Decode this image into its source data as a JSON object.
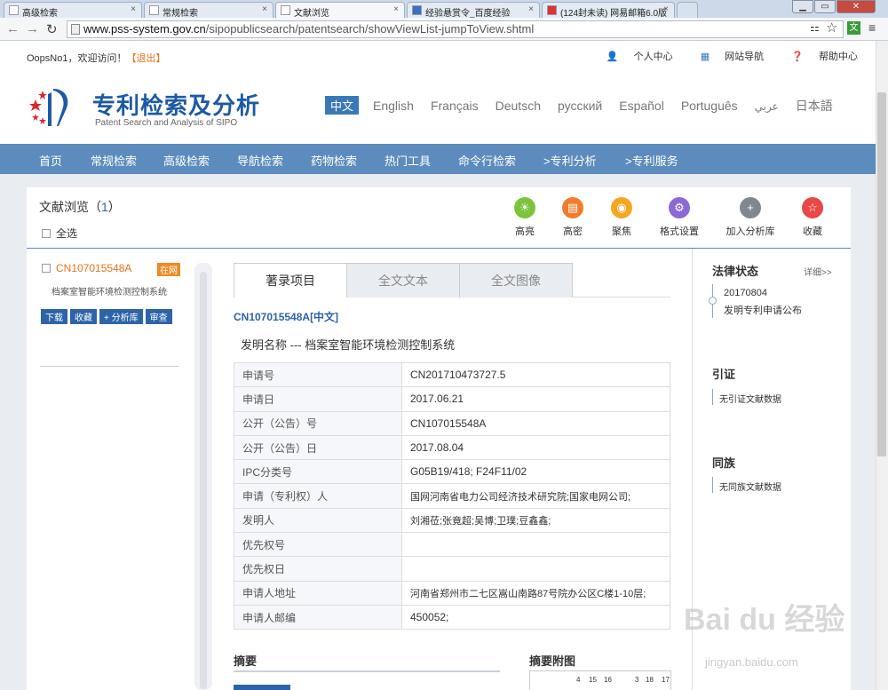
{
  "browser": {
    "tabs": [
      {
        "label": "高级检索"
      },
      {
        "label": "常规检索"
      },
      {
        "label": "文献浏览"
      },
      {
        "label": "经验悬赏令_百度经验"
      },
      {
        "label": "(124封未读) 网易邮箱6.0版"
      }
    ],
    "url_host": "www.pss-system.gov.cn",
    "url_path": "/sipopublicsearch/patentsearch/showViewList-jumpToView.shtml"
  },
  "topbar": {
    "welcome": "OopsNo1，欢迎访问！",
    "logout": "【退出】",
    "links": [
      "个人中心",
      "网站导航",
      "帮助中心"
    ]
  },
  "header": {
    "title": "专利检索及分析",
    "subtitle": "Patent Search and Analysis of SIPO",
    "current_lang": "中文",
    "languages": [
      "English",
      "Français",
      "Deutsch",
      "русский",
      "Español",
      "Português",
      "عربي",
      "日本語"
    ]
  },
  "nav": [
    "首页",
    "常规检索",
    "高级检索",
    "导航检索",
    "药物检索",
    "热门工具",
    "命令行检索",
    ">专利分析",
    ">专利服务"
  ],
  "viewer": {
    "title": "文献浏览（",
    "count": "1",
    "title_end": "）",
    "select_all": "全选",
    "tools": [
      {
        "label": "高亮",
        "color": "#7cc43b",
        "icon": "bulb-icon"
      },
      {
        "label": "高密",
        "color": "#f27c2b",
        "icon": "doc-icon"
      },
      {
        "label": "聚焦",
        "color": "#f5a623",
        "icon": "eye-icon"
      },
      {
        "label": "格式设置",
        "color": "#8b6ad6",
        "icon": "gear-icon"
      },
      {
        "label": "加入分析库",
        "color": "#7f8890",
        "icon": "plus-icon"
      },
      {
        "label": "收藏",
        "color": "#e84848",
        "icon": "star-icon"
      }
    ]
  },
  "left": {
    "patent_no": "CN107015548A",
    "tag": "在网",
    "title": "档案室智能环境检测控制系统",
    "buttons": [
      "下载",
      "收藏",
      "+ 分析库",
      "审查"
    ]
  },
  "content": {
    "tabs": [
      "著录项目",
      "全文文本",
      "全文图像"
    ],
    "patent_no": "CN107015548A[中文]",
    "invention_name": "发明名称 --- 档案室智能环境检测控制系统",
    "rows": [
      {
        "k": "申请号",
        "v": "CN201710473727.5"
      },
      {
        "k": "申请日",
        "v": "2017.06.21"
      },
      {
        "k": "公开（公告）号",
        "v": "CN107015548A"
      },
      {
        "k": "公开（公告）日",
        "v": "2017.08.04"
      },
      {
        "k": "IPC分类号",
        "v": "G05B19/418; F24F11/02"
      },
      {
        "k": "申请（专利权）人",
        "v": "国网河南省电力公司经济技术研究院;国家电网公司;"
      },
      {
        "k": "发明人",
        "v": "刘湘莅;张竟超;吴博;卫璞;豆鑫鑫;"
      },
      {
        "k": "优先权号",
        "v": ""
      },
      {
        "k": "优先权日",
        "v": ""
      },
      {
        "k": "申请人地址",
        "v": "河南省郑州市二七区嵩山南路87号院办公区C楼1-10层;"
      },
      {
        "k": "申请人邮编",
        "v": "450052;"
      }
    ],
    "abstract_label": "摘要",
    "abstract_fig_label": "摘要附图",
    "fig_numbers": [
      "4",
      "15",
      "16",
      "3",
      "18",
      "17"
    ]
  },
  "right": {
    "legal_status": "法律状态",
    "more": "详细>>",
    "legal_date": "20170804",
    "legal_event": "发明专利申请公布",
    "citation": "引证",
    "citation_text": "无引证文献数据",
    "family": "同族",
    "family_text": "无同族文献数据"
  },
  "watermark": {
    "main": "Bai du 经验",
    "sub": "jingyan.baidu.com"
  }
}
